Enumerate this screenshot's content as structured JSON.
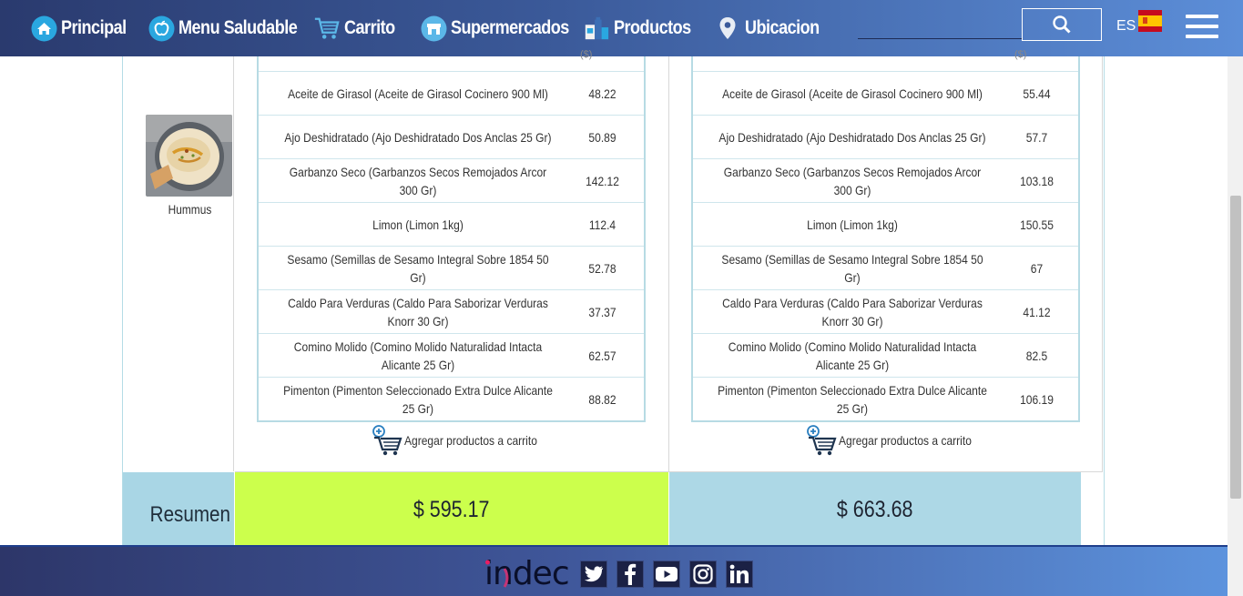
{
  "nav": {
    "items": [
      {
        "label": "Principal",
        "icon": "home-icon"
      },
      {
        "label": "Menu Saludable",
        "icon": "apple-icon"
      },
      {
        "label": "Carrito",
        "icon": "cart-icon"
      },
      {
        "label": "Supermercados",
        "icon": "store-icon"
      },
      {
        "label": "Productos",
        "icon": "products-icon"
      },
      {
        "label": "Ubicacion",
        "icon": "location-icon"
      }
    ],
    "language": "ES",
    "flag_icon": "spain-flag-icon"
  },
  "recipe": {
    "name": "Hummus",
    "image_icon": "hummus-photo"
  },
  "stores": [
    {
      "products": [
        {
          "name": "Aceite de Girasol (Aceite de Girasol Cocinero 900 Ml)",
          "price": "48.22"
        },
        {
          "name": "Ajo Deshidratado (Ajo Deshidratado Dos Anclas 25 Gr)",
          "price": "50.89"
        },
        {
          "name": "Garbanzo Seco (Garbanzos Secos Remojados Arcor 300 Gr)",
          "price": "142.12"
        },
        {
          "name": "Limon (Limon 1kg)",
          "price": "112.4"
        },
        {
          "name": "Sesamo (Semillas de Sesamo Integral Sobre 1854 50 Gr)",
          "price": "52.78"
        },
        {
          "name": "Caldo Para Verduras (Caldo Para Saborizar Verduras Knorr 30 Gr)",
          "price": "37.37"
        },
        {
          "name": "Comino Molido (Comino Molido Naturalidad Intacta Alicante 25 Gr)",
          "price": "62.57"
        },
        {
          "name": "Pimenton (Pimenton Seleccionado Extra Dulce Alicante 25 Gr)",
          "price": "88.82"
        }
      ],
      "add_to_cart": "Agregar productos a carrito",
      "total": "$ 595.17",
      "total_color": "#ccff4c"
    },
    {
      "products": [
        {
          "name": "Aceite de Girasol (Aceite de Girasol Cocinero 900 Ml)",
          "price": "55.44"
        },
        {
          "name": "Ajo Deshidratado (Ajo Deshidratado Dos Anclas 25 Gr)",
          "price": "57.7"
        },
        {
          "name": "Garbanzo Seco (Garbanzos Secos Remojados Arcor 300 Gr)",
          "price": "103.18"
        },
        {
          "name": "Limon (Limon 1kg)",
          "price": "150.55"
        },
        {
          "name": "Sesamo (Semillas de Sesamo Integral Sobre 1854 50 Gr)",
          "price": "67"
        },
        {
          "name": "Caldo Para Verduras (Caldo Para Saborizar Verduras Knorr 30 Gr)",
          "price": "41.12"
        },
        {
          "name": "Comino Molido (Comino Molido Naturalidad Intacta Alicante 25 Gr)",
          "price": "82.5"
        },
        {
          "name": "Pimenton (Pimenton Seleccionado Extra Dulce Alicante 25 Gr)",
          "price": "106.19"
        }
      ],
      "add_to_cart": "Agregar productos a carrito",
      "total": "$ 663.68",
      "total_color": "#add8e6"
    }
  ],
  "summary": {
    "label": "Resumen"
  },
  "header_partial": "($)",
  "footer": {
    "logo_text": "indec",
    "social": [
      "twitter-icon",
      "facebook-icon",
      "youtube-icon",
      "instagram-icon",
      "linkedin-icon"
    ]
  },
  "colors": {
    "nav_start": "#2a3a6e",
    "nav_end": "#5c8ed8",
    "border_blue": "#b7dbe4",
    "summary_bg": "#a9d6e5"
  }
}
